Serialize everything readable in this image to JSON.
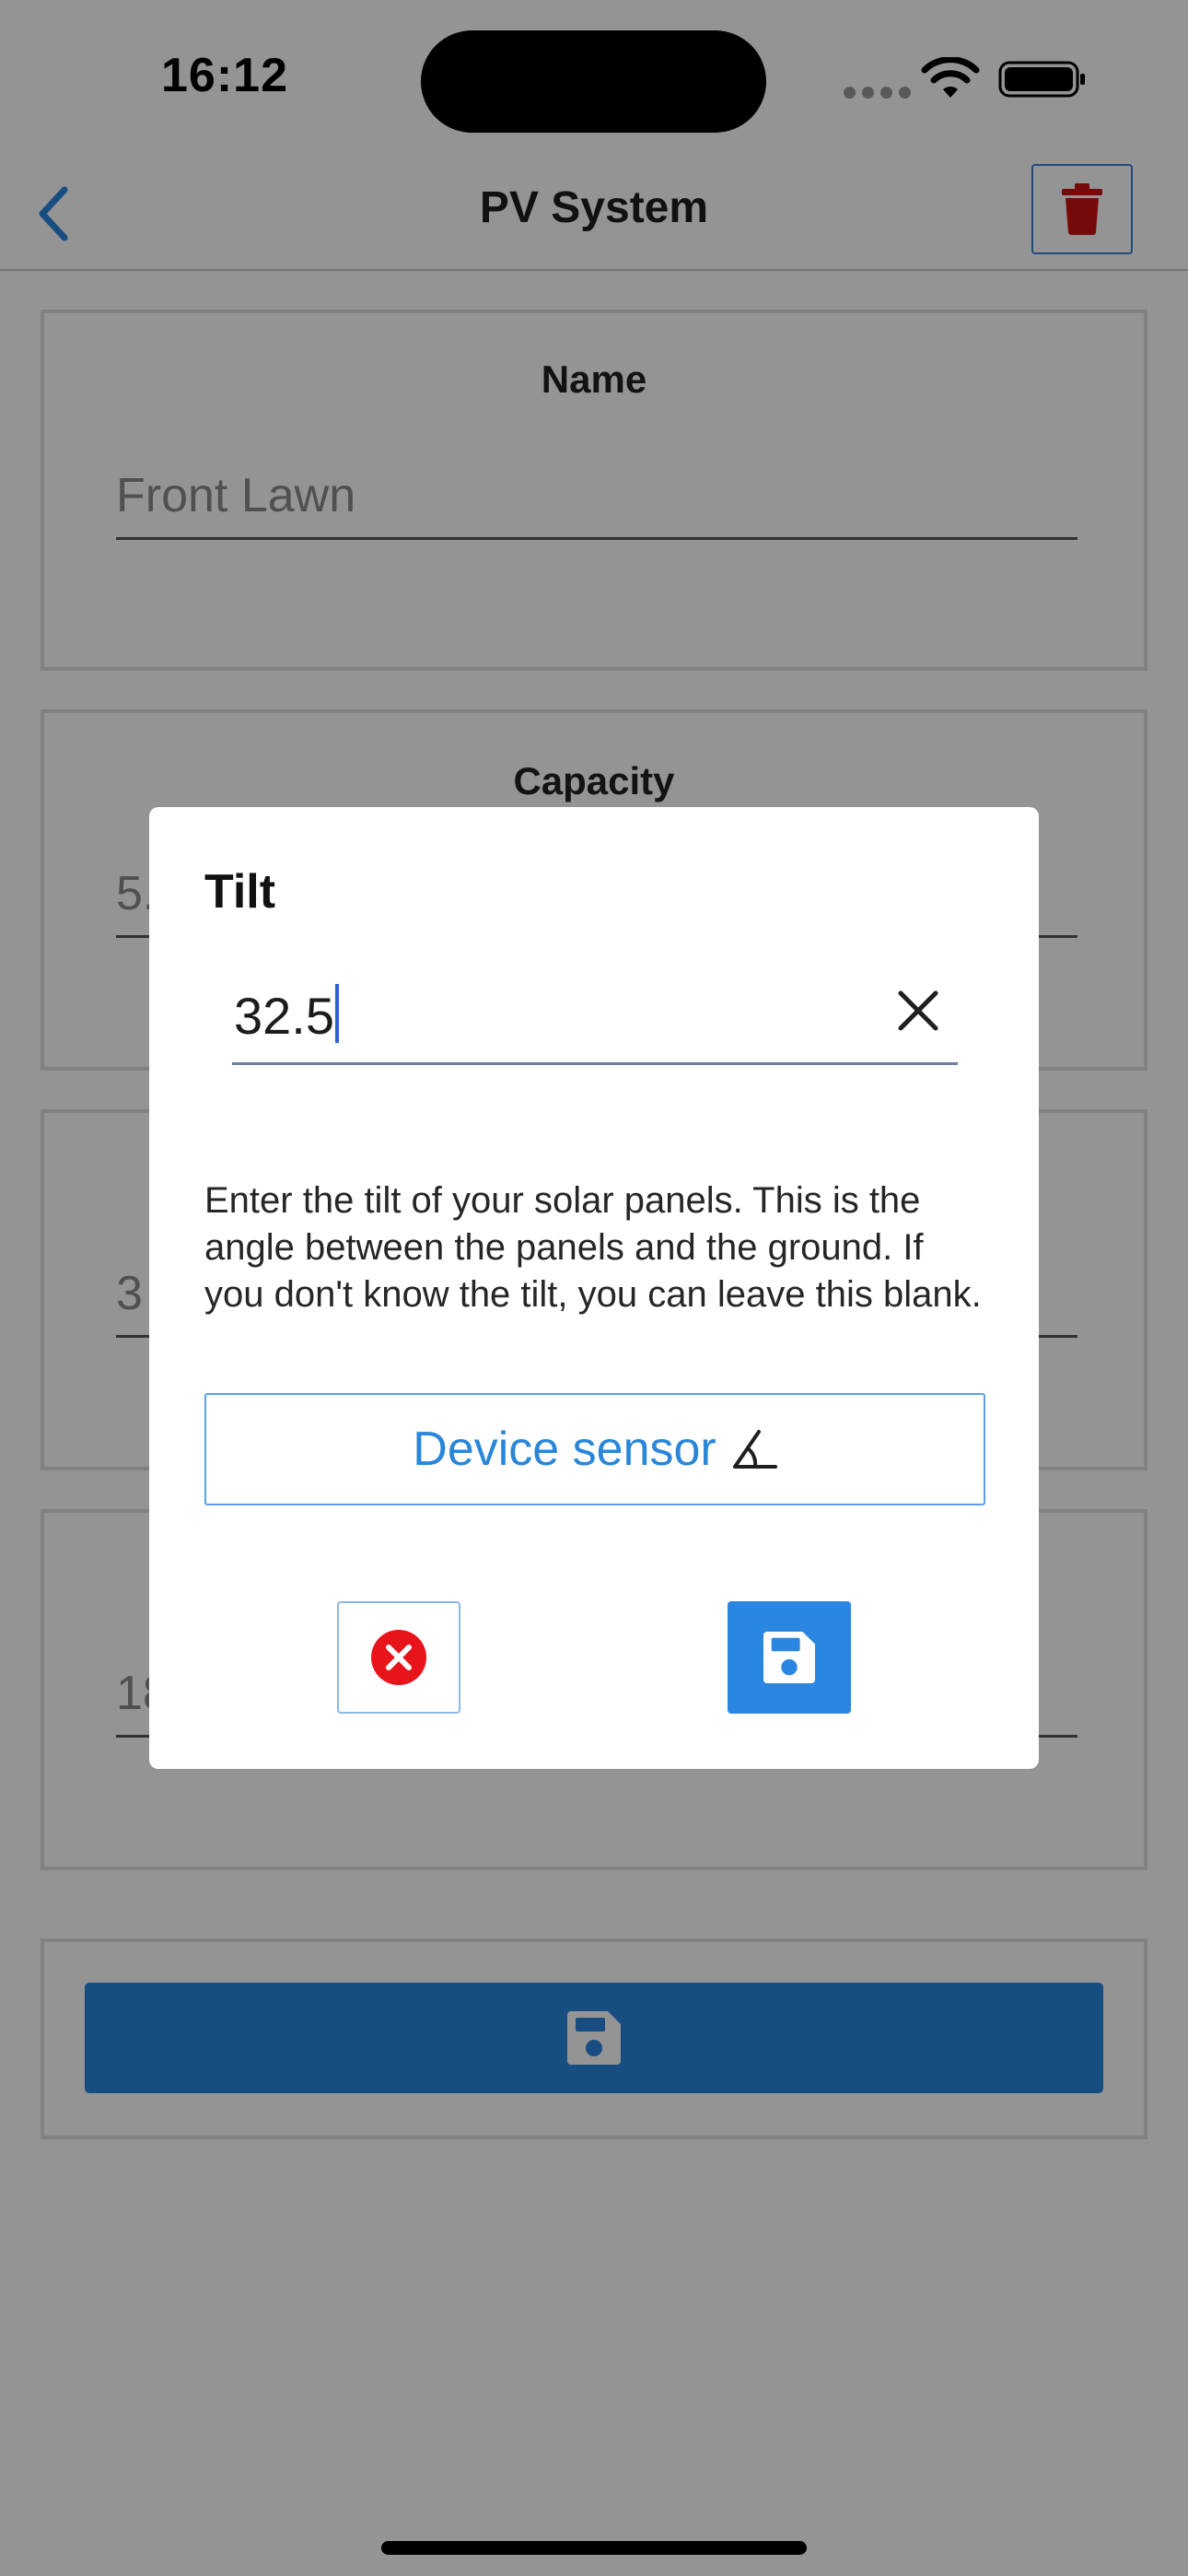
{
  "status_bar": {
    "time": "16:12"
  },
  "nav": {
    "title": "PV System"
  },
  "form": {
    "fields": [
      {
        "label": "Name",
        "value": "Front Lawn"
      },
      {
        "label": "Capacity",
        "value": "5."
      },
      {
        "label": "",
        "value": "3"
      },
      {
        "label": "",
        "value": "18"
      }
    ]
  },
  "dialog": {
    "title": "Tilt",
    "input_value": "32.5",
    "help_text": "Enter the tilt of your solar panels. This is the angle between the panels and the ground. If you don't know the tilt, you can leave this blank.",
    "sensor_button_label": "Device sensor"
  },
  "colors": {
    "accent": "#2a86e0",
    "delete": "#cc1111",
    "cancel": "#e8141c"
  },
  "icons": [
    "back-chevron-icon",
    "trash-icon",
    "clear-x-icon",
    "angle-icon",
    "cancel-x-circle-icon",
    "floppy-disk-icon"
  ]
}
